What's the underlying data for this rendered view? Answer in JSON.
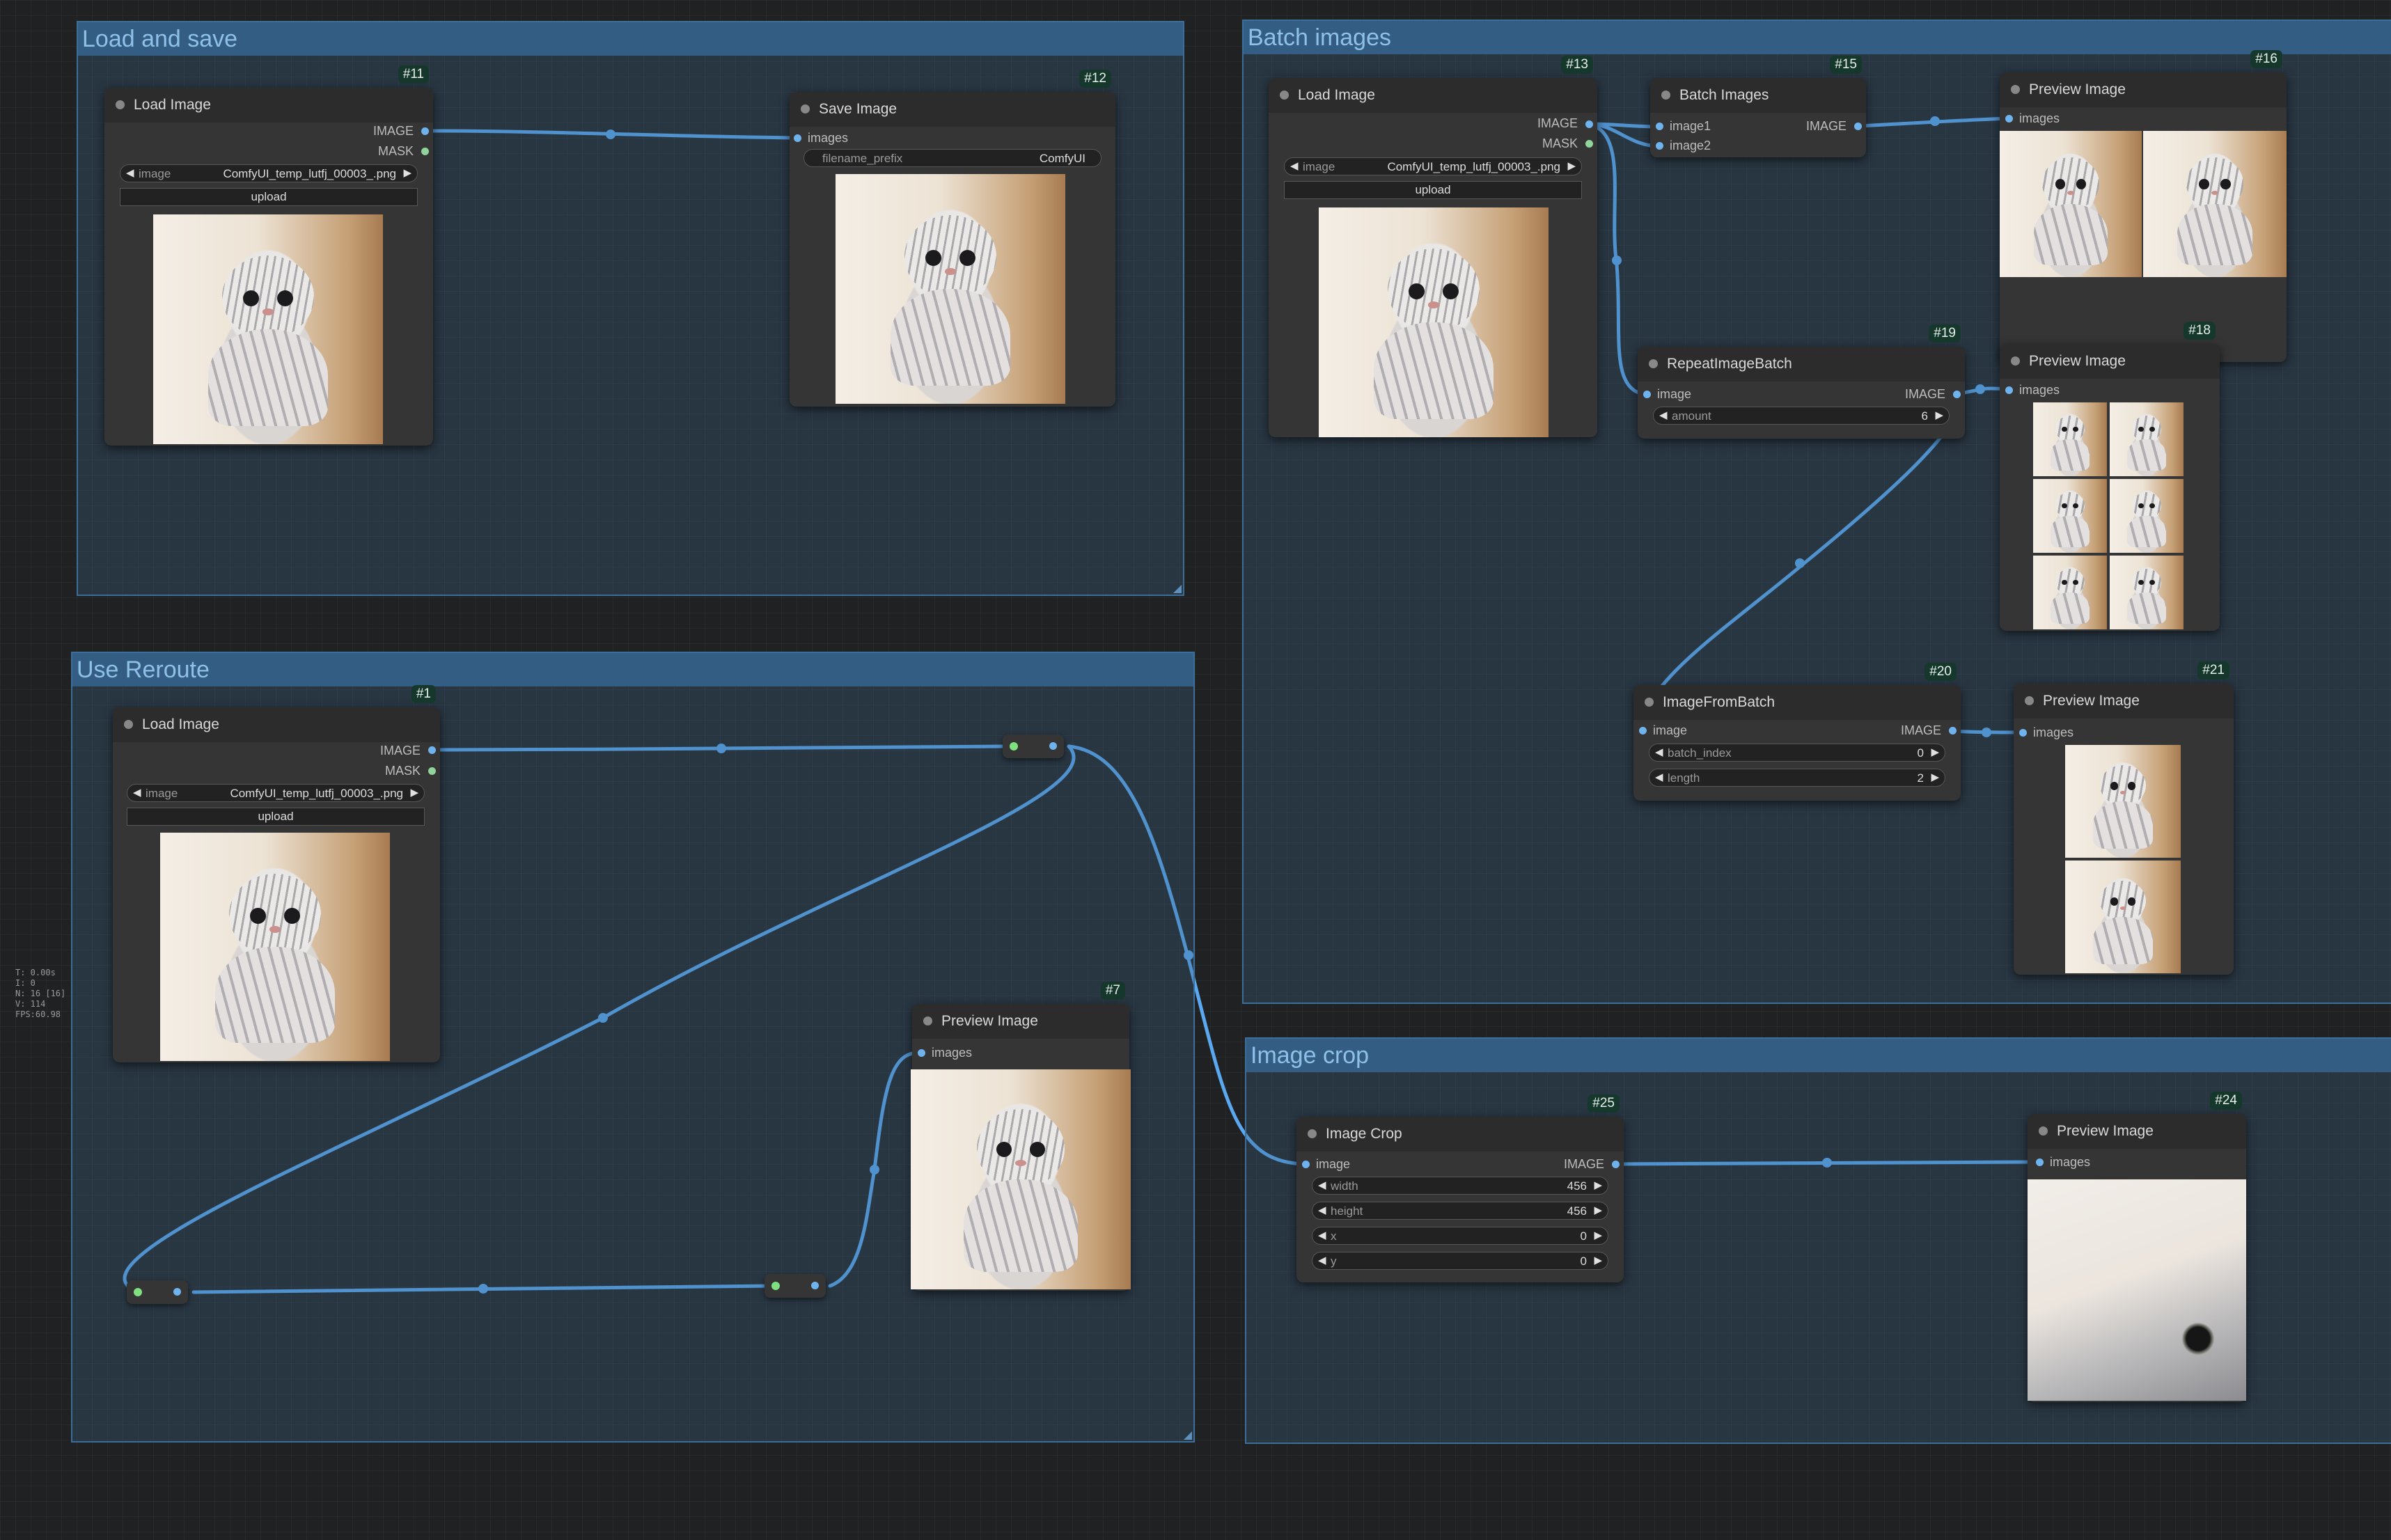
{
  "groups": {
    "load_and_save": "Load and save",
    "batch_images": "Batch images",
    "use_reroute": "Use Reroute",
    "image_crop": "Image crop"
  },
  "ports": {
    "image_upper": "IMAGE",
    "mask_upper": "MASK",
    "images": "images",
    "image": "image",
    "image1": "image1",
    "image2": "image2"
  },
  "nodes": {
    "n11": {
      "id": "#11",
      "title": "Load Image",
      "image_label": "image",
      "image_value": "ComfyUI_temp_lutfj_00003_.png",
      "upload_label": "upload"
    },
    "n12": {
      "id": "#12",
      "title": "Save Image",
      "prefix_label": "filename_prefix",
      "prefix_value": "ComfyUI"
    },
    "n13": {
      "id": "#13",
      "title": "Load Image",
      "image_label": "image",
      "image_value": "ComfyUI_temp_lutfj_00003_.png",
      "upload_label": "upload"
    },
    "n15": {
      "id": "#15",
      "title": "Batch Images"
    },
    "n16": {
      "id": "#16",
      "title": "Preview Image"
    },
    "n19": {
      "id": "#19",
      "title": "RepeatImageBatch",
      "amount_label": "amount",
      "amount_value": "6"
    },
    "n18": {
      "id": "#18",
      "title": "Preview Image"
    },
    "n20": {
      "id": "#20",
      "title": "ImageFromBatch",
      "batch_index_label": "batch_index",
      "batch_index_value": "0",
      "length_label": "length",
      "length_value": "2"
    },
    "n21": {
      "id": "#21",
      "title": "Preview Image"
    },
    "n1": {
      "id": "#1",
      "title": "Load Image",
      "image_label": "image",
      "image_value": "ComfyUI_temp_lutfj_00003_.png",
      "upload_label": "upload"
    },
    "n7": {
      "id": "#7",
      "title": "Preview Image"
    },
    "n25": {
      "id": "#25",
      "title": "Image Crop",
      "width_label": "width",
      "width_value": "456",
      "height_label": "height",
      "height_value": "456",
      "x_label": "x",
      "x_value": "0",
      "y_label": "y",
      "y_value": "0"
    },
    "n24": {
      "id": "#24",
      "title": "Preview Image"
    }
  },
  "stats": {
    "t": "T: 0.00s",
    "i": "I: 0",
    "n": "N: 16 [16]",
    "v": "V: 114",
    "fps": "FPS:60.98"
  },
  "colors": {
    "canvas_bg": "#202123",
    "group_fill": "#3a6287",
    "group_title": "#8fc0e8",
    "link": "#5aa8f0",
    "node_bg": "#353535",
    "id_badge": "#16382c"
  }
}
